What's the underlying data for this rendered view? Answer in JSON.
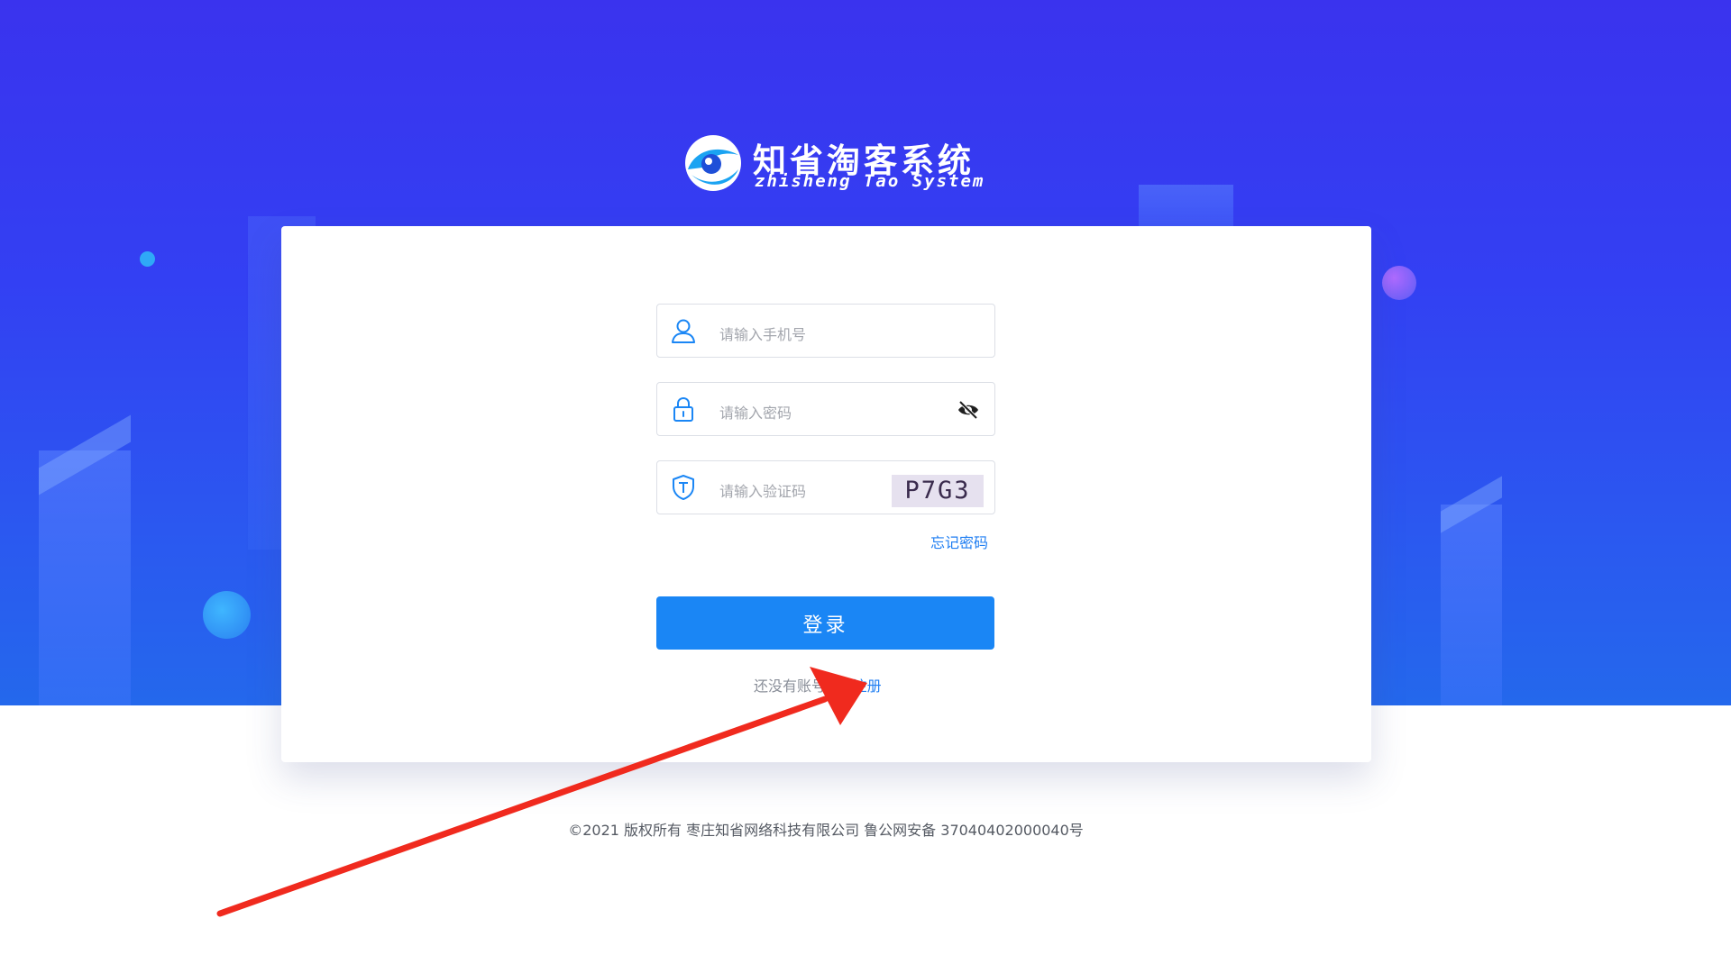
{
  "logo": {
    "cn": "知省淘客系统",
    "en": "zhisheng Tao System",
    "icon": "eye-wave-logo"
  },
  "form": {
    "phone": {
      "placeholder": "请输入手机号",
      "icon": "user-icon"
    },
    "password": {
      "placeholder": "请输入密码",
      "icon": "lock-icon",
      "toggle_icon": "eye-slash-icon"
    },
    "captcha": {
      "placeholder": "请输入验证码",
      "icon": "shield-icon",
      "code": "P7G3"
    },
    "forgot_label": "忘记密码",
    "login_label": "登录",
    "register_prompt": "还没有账号?",
    "register_label": "去注册"
  },
  "footer": {
    "text": "©2021 版权所有 枣庄知省网络科技有限公司 鲁公网安备 37040402000040号"
  },
  "colors": {
    "background_top": "#3a33ee",
    "background_bottom": "#2468ec",
    "primary": "#1a86f5",
    "link": "#1f7ef2",
    "annotation_arrow": "#f02a1e"
  }
}
